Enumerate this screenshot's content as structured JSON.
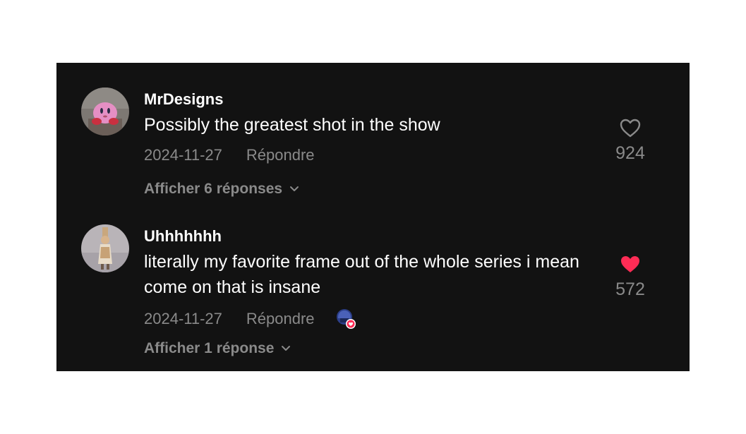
{
  "comments": [
    {
      "username": "MrDesigns",
      "text": "Possibly the greatest shot in the show",
      "date": "2024-11-27",
      "reply_label": "Répondre",
      "likes": "924",
      "liked": false,
      "view_replies": "Afficher 6 réponses",
      "avatar_icon": "pink-plush-avatar"
    },
    {
      "username": "Uhhhhhhh",
      "text": "literally my favorite frame out of the whole series i mean come on that is insane",
      "date": "2024-11-27",
      "reply_label": "Répondre",
      "likes": "572",
      "liked": true,
      "view_replies": "Afficher 1 réponse",
      "avatar_icon": "figure-avatar",
      "creator_liked_badge": "creator-liked-icon"
    }
  ],
  "colors": {
    "background": "#121212",
    "text_primary": "#ffffff",
    "text_secondary": "#8a8a8a",
    "like_active": "#fe2c55"
  }
}
